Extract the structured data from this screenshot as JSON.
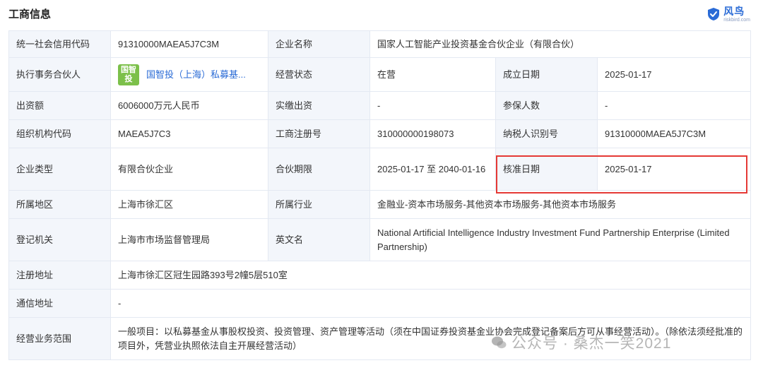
{
  "header": {
    "title": "工商信息",
    "brand_name": "风鸟",
    "brand_domain": "riskbird.com"
  },
  "rows": [
    {
      "c1_label": "统一社会信用代码",
      "c1_value": "91310000MAEA5J7C3M",
      "c2_label": "企业名称",
      "c2_value": "国家人工智能产业投资基金合伙企业（有限合伙）"
    },
    {
      "c1_label": "执行事务合伙人",
      "partner_logo_top": "国智",
      "partner_logo_bottom": "投",
      "c1_value": "国智投（上海）私募基...",
      "c2_label": "经营状态",
      "c2_value": "在营",
      "c3_label": "成立日期",
      "c3_value": "2025-01-17"
    },
    {
      "c1_label": "出资额",
      "c1_value": "6006000万元人民币",
      "c2_label": "实缴出资",
      "c2_value": "-",
      "c3_label": "参保人数",
      "c3_value": "-"
    },
    {
      "c1_label": "组织机构代码",
      "c1_value": "MAEA5J7C3",
      "c2_label": "工商注册号",
      "c2_value": "310000000198073",
      "c3_label": "纳税人识别号",
      "c3_value": "91310000MAEA5J7C3M"
    },
    {
      "c1_label": "企业类型",
      "c1_value": "有限合伙企业",
      "c2_label": "合伙期限",
      "c2_value": "2025-01-17 至 2040-01-16",
      "c3_label": "核准日期",
      "c3_value": "2025-01-17"
    },
    {
      "c1_label": "所属地区",
      "c1_value": "上海市徐汇区",
      "c2_label": "所属行业",
      "c2_value": "金融业-资本市场服务-其他资本市场服务-其他资本市场服务"
    },
    {
      "c1_label": "登记机关",
      "c1_value": "上海市市场监督管理局",
      "c2_label": "英文名",
      "c2_value": "National Artificial Intelligence Industry Investment Fund Partnership Enterprise (Limited Partnership)"
    },
    {
      "c1_label": "注册地址",
      "c1_value": "上海市徐汇区冠生园路393号2幢5层510室"
    },
    {
      "c1_label": "通信地址",
      "c1_value": "-"
    },
    {
      "c1_label": "经营业务范围",
      "c1_value": "一般项目：以私募基金从事股权投资、投资管理、资产管理等活动（须在中国证券投资基金业协会完成登记备案后方可从事经营活动）。（除依法须经批准的项目外，凭营业执照依法自主开展经营活动）"
    }
  ],
  "watermark": {
    "text": "公众号 · 桑杰一笑2021"
  },
  "colors": {
    "label_bg": "#f3f6fb",
    "border": "#e4e9f2",
    "link": "#2a6bd6",
    "logo_green": "#7cc04a",
    "highlight": "#e53935"
  }
}
